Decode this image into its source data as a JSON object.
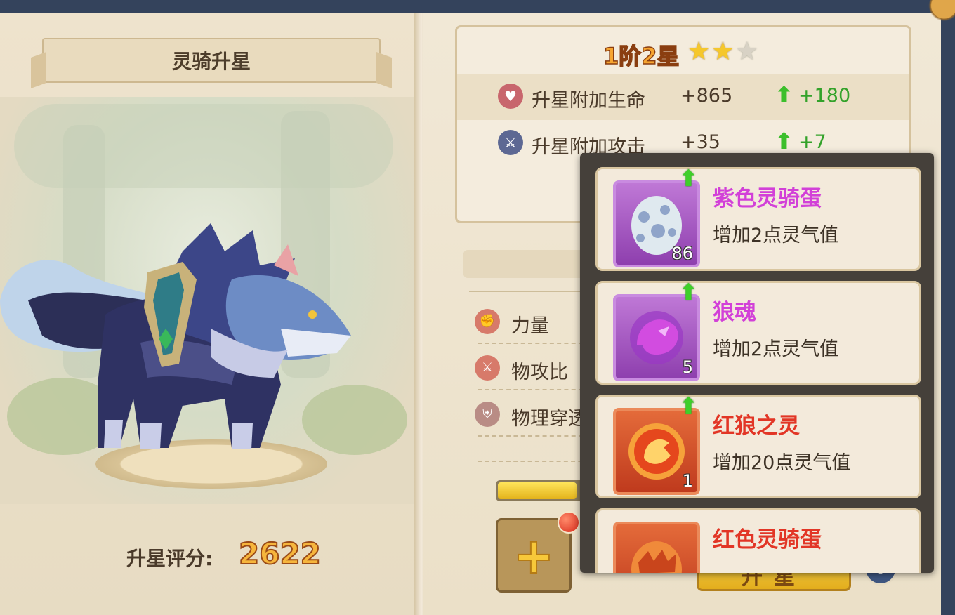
{
  "window_title": "灵骑升星",
  "score": {
    "label": "升星评分:",
    "value": "2622"
  },
  "star_level": {
    "text": "1阶2星",
    "filled": 2,
    "total": 3
  },
  "stats": [
    {
      "icon": "heart-icon",
      "name": "升星附加生命",
      "value": "+865",
      "increase": "+180"
    },
    {
      "icon": "sword-icon",
      "name": "升星附加攻击",
      "value": "+35",
      "increase": "+7"
    }
  ],
  "attributes": [
    {
      "icon": "strength-icon",
      "name": "力量"
    },
    {
      "icon": "attack-ratio-icon",
      "name": "物攻比"
    },
    {
      "icon": "penetration-icon",
      "name": "物理穿透"
    }
  ],
  "progress": {
    "fraction": 0.9
  },
  "upgrade_button": {
    "label": "升星"
  },
  "info_button": {
    "label": "!"
  },
  "add_button": {
    "label": "+"
  },
  "popup_items": [
    {
      "name": "紫色灵骑蛋",
      "desc": "增加2点灵气值",
      "count": "86",
      "rarity": "purple",
      "icon": "purple-egg-icon"
    },
    {
      "name": "狼魂",
      "desc": "增加2点灵气值",
      "count": "5",
      "rarity": "purple",
      "icon": "wolf-soul-icon"
    },
    {
      "name": "红狼之灵",
      "desc": "增加20点灵气值",
      "count": "1",
      "rarity": "red",
      "icon": "red-wolf-spirit-icon"
    },
    {
      "name": "红色灵骑蛋",
      "desc": "",
      "count": "",
      "rarity": "red",
      "icon": "red-egg-icon"
    }
  ],
  "colors": {
    "purple_item": "#d240d8",
    "red_item": "#e23626",
    "increase_green": "#33a22a",
    "score_gold": "#f6b53c"
  }
}
